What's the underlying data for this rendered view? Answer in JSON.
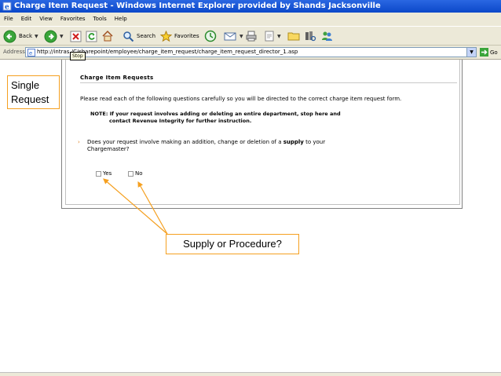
{
  "window": {
    "title": "Charge Item Request - Windows Internet Explorer provided by Shands Jacksonville"
  },
  "menu": [
    "File",
    "Edit",
    "View",
    "Favorites",
    "Tools",
    "Help"
  ],
  "toolbar": {
    "back_label": "Back",
    "search_label": "Search",
    "favorites_label": "Favorites"
  },
  "address": {
    "label": "Address",
    "url": "http://intras     /C/sharepoint/employee/charge_item_request/charge_item_request_director_1.asp",
    "go_label": "Go",
    "tooltip": "Stop"
  },
  "page": {
    "header": "Charge Item Requests",
    "instruction": "Please read each of the following questions carefully so you will be directed to the correct charge item request form.",
    "note_line1": "NOTE:  If your request involves adding or deleting an entire department, stop here and",
    "note_line2": "contact Revenue Integrity for further instruction.",
    "bullet": "›",
    "question_part1": "Does your request involve making an addition, change or deletion of a ",
    "question_bold": "supply",
    "question_part2": " to your",
    "question_line2": "Chargemaster?",
    "option_yes": "Yes",
    "option_no": "No"
  },
  "annotations": {
    "callout1_line1": "Single",
    "callout1_line2": "Request",
    "callout2": "Supply or Procedure?"
  },
  "colors": {
    "titlebar": "#0b48c9",
    "chrome": "#ece9d8",
    "callout_border": "#f5a020",
    "arrow": "#f5a020"
  }
}
